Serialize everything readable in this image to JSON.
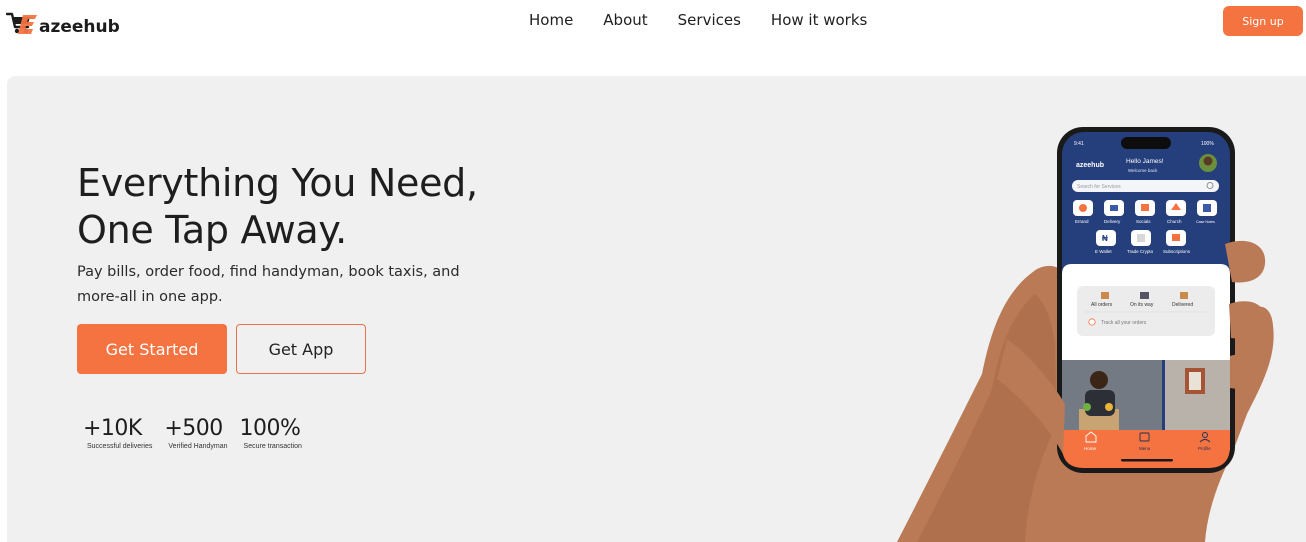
{
  "brand": {
    "name": "azeehub",
    "logo_letter": "E"
  },
  "nav": {
    "links": [
      "Home",
      "About",
      "Services",
      "How it works"
    ],
    "signup": "Sign up"
  },
  "hero": {
    "headline_line1": "Everything You Need,",
    "headline_line2": "One Tap Away.",
    "subtitle": "Pay bills, order food, find handyman, book taxis, and more-all in one app.",
    "cta_primary": "Get Started",
    "cta_secondary": "Get App",
    "stats": [
      {
        "value": "+10K",
        "label": "Successful deliveries"
      },
      {
        "value": "+500",
        "label": "Verified Handyman"
      },
      {
        "value": "100%",
        "label": "Secure transaction"
      }
    ]
  },
  "phone": {
    "status_time": "9:41",
    "battery": "100%",
    "app_name": "azeehub",
    "greeting": "Hello James!",
    "welcome": "Welcome back",
    "search_placeholder": "Search for Services",
    "services_row1": [
      "Errand",
      "Delivery",
      "Socials",
      "Church",
      "Case Notes"
    ],
    "services_row2": [
      "E Wallet",
      "Trade Crypto",
      "Subscriptions"
    ],
    "orders": [
      "All orders",
      "On its way",
      "Delivered"
    ],
    "track": "Track all your orders",
    "bottom_nav": [
      "Home",
      "Menu",
      "Profile"
    ]
  },
  "colors": {
    "accent": "#f47340",
    "app_blue": "#253f7d",
    "hero_bg": "#f0f0f0"
  }
}
